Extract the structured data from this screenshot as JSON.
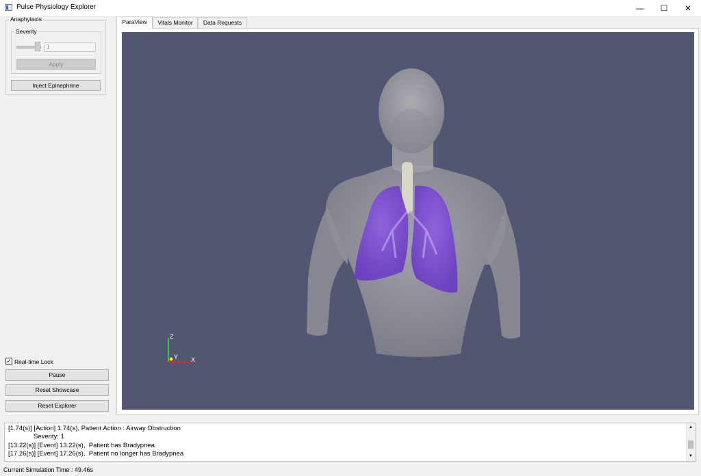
{
  "window": {
    "title": "Pulse Physiology Explorer",
    "minimize": "—",
    "maximize": "☐",
    "close": "✕"
  },
  "left_panel": {
    "group_title": "Anaphylaxis",
    "severity_label": "Severity",
    "severity_value": "1",
    "severity_level": 1.0,
    "apply_label": "Apply",
    "inject_label": "Inject Epinephrine",
    "realtime_label": "Real-time Lock",
    "realtime_checked": "✓",
    "pause_label": "Pause",
    "reset_showcase_label": "Reset Showcase",
    "reset_explorer_label": "Reset Explorer"
  },
  "tabs": [
    {
      "label": "ParaView",
      "active": true
    },
    {
      "label": "Vitals Monitor",
      "active": false
    },
    {
      "label": "Data Requests",
      "active": false
    }
  ],
  "axes": {
    "z": "Z",
    "y": "Y",
    "x": "X"
  },
  "log": {
    "lines": [
      "[1.74(s)] [Action] 1.74(s), Patient Action : Airway Obstruction",
      "              Severity: 1",
      "[13.22(s)] [Event] 13.22(s),  Patient has Bradypnea",
      "[17.26(s)] [Event] 17.26(s),  Patient no longer has Bradypnea"
    ]
  },
  "status": "Current Simulation Time : 49.46s",
  "colors": {
    "viewport_bg": "#525672",
    "lung": "#7a4fcf",
    "body": "#9a9aa0"
  }
}
